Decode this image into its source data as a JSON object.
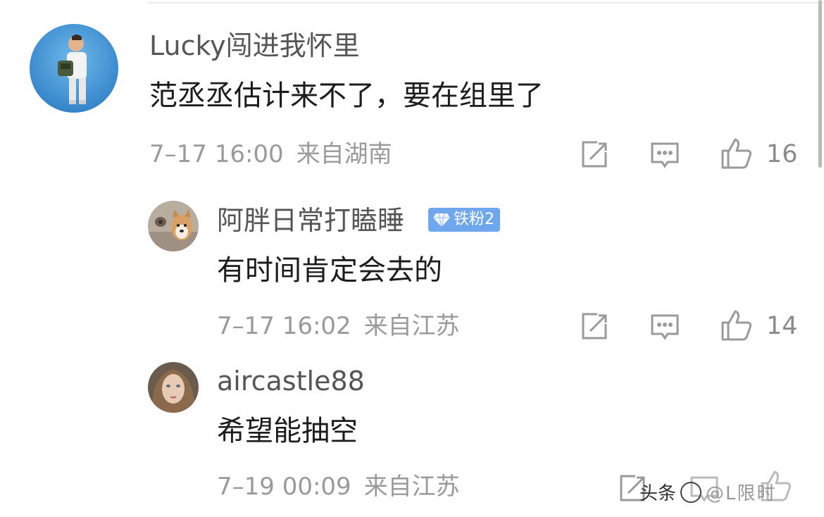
{
  "comments": [
    {
      "username": "Lucky闯进我怀里",
      "text": "范丞丞估计来不了，要在组里了",
      "time": "7–17 16:00",
      "location": "来自湖南",
      "likes": "16"
    },
    {
      "username": "阿胖日常打瞌睡",
      "badge": "铁粉2",
      "text": "有时间肯定会去的",
      "time": "7–17 16:02",
      "location": "来自江苏",
      "likes": "14"
    },
    {
      "username": "aircastle88",
      "text": "希望能抽空",
      "time": "7–19 00:09",
      "location": "来自江苏",
      "likes": ""
    }
  ],
  "watermark": {
    "label": "头条",
    "handle": "@L​限时"
  },
  "icons": {
    "repost": "repost-icon",
    "reply": "reply-icon",
    "like": "thumbs-up-icon"
  },
  "colors": {
    "username": "#555555",
    "meta": "#9a9a9a",
    "badge": "#6ea7ee"
  }
}
